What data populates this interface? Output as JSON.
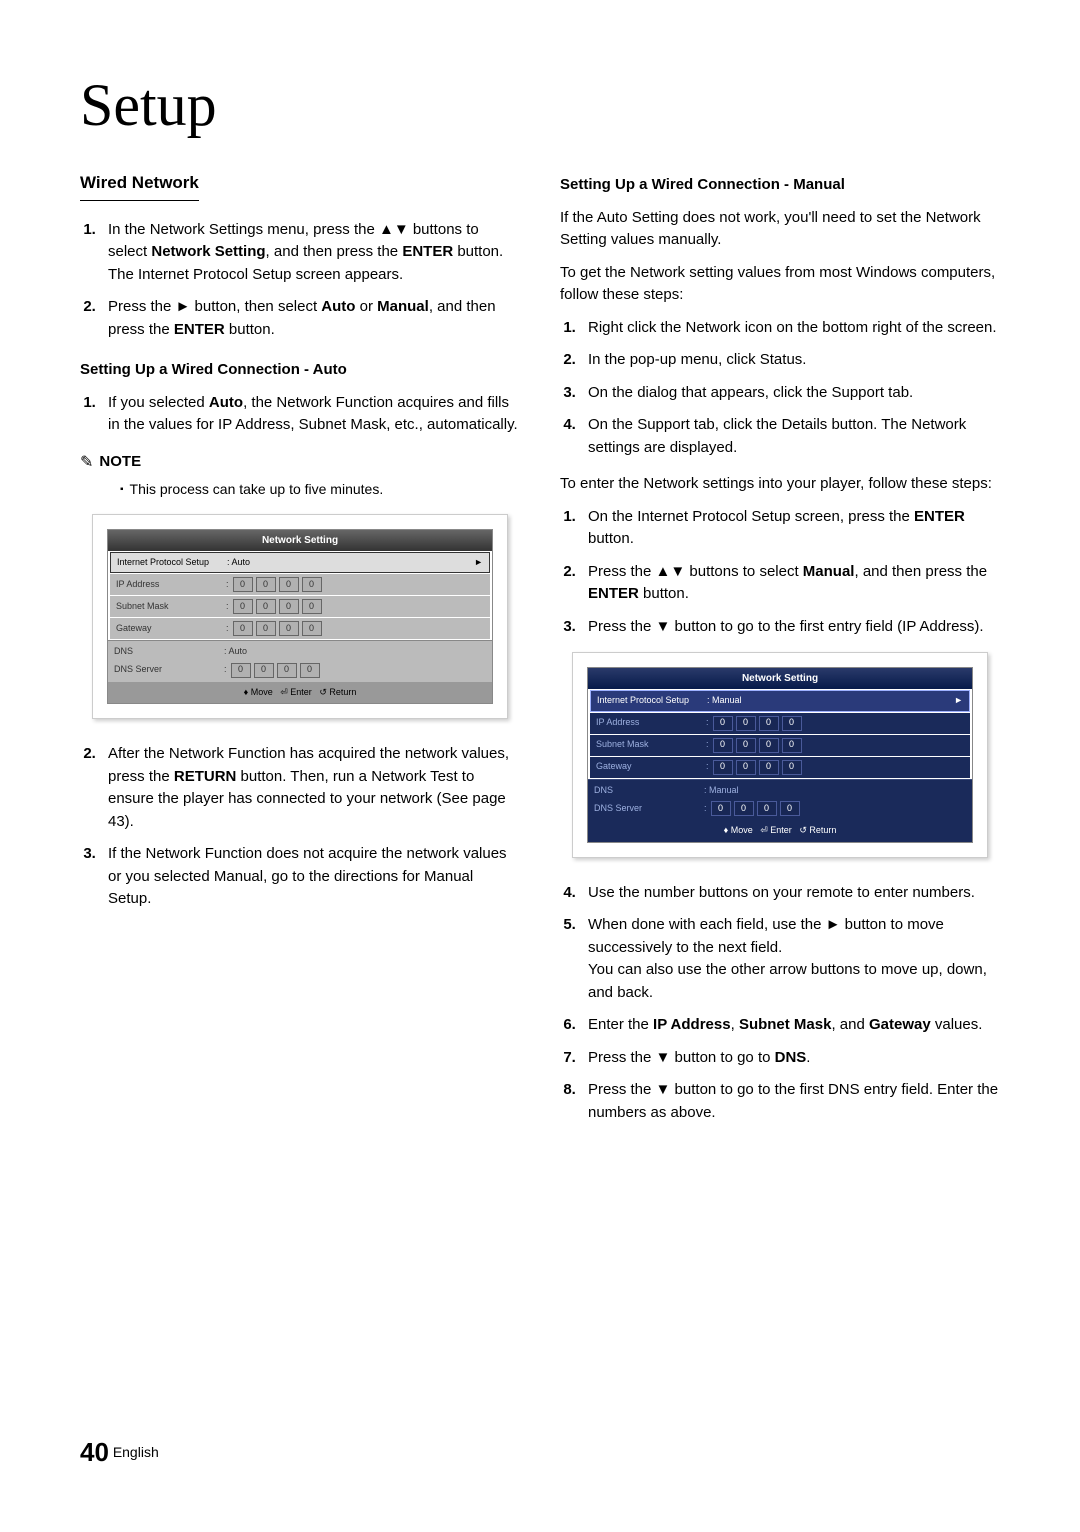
{
  "title": "Setup",
  "page_number": "40",
  "lang": "English",
  "left": {
    "section": "Wired Network",
    "steps_a": [
      "In the Network Settings menu, press the ▲▼ buttons to select Network Setting, and then press the ENTER button. The Internet Protocol Setup screen appears.",
      "Press the ► button, then select Auto or Manual, and then press the ENTER button."
    ],
    "sub_a": "Setting Up a Wired Connection - Auto",
    "steps_b": [
      "If you selected Auto, the Network Function acquires and fills in the values for IP Address, Subnet Mask, etc., automatically."
    ],
    "note_label": "NOTE",
    "note_body": "This process can take up to five minutes.",
    "steps_c": [
      "After the Network Function has acquired the network values, press the RETURN button. Then, run a Network Test to ensure the player has connected to your network (See page 43).",
      "If the Network Function does not acquire the network values or you selected Manual, go to the directions for Manual Setup."
    ]
  },
  "right": {
    "sub": "Setting Up a Wired Connection - Manual",
    "p1": "If the Auto Setting does not work, you'll need to set the Network Setting values manually.",
    "p2": "To get the Network setting values from most Windows computers, follow these steps:",
    "steps_a": [
      "Right click the Network icon on the bottom right of the screen.",
      "In the pop-up menu, click Status.",
      "On the dialog that appears, click the Support tab.",
      "On the Support tab, click the Details button. The Network settings are displayed."
    ],
    "p3": "To enter the Network settings into your player, follow these steps:",
    "steps_b": [
      "On the Internet Protocol Setup screen, press the ENTER button.",
      "Press the ▲▼ buttons to select Manual, and then press the ENTER button.",
      "Press the ▼ button to go to the first entry field (IP Address)."
    ],
    "steps_c": [
      "Use the number buttons on your remote to enter numbers.",
      "When done with each field, use the ► button to move successively to the next field. You can also use the other arrow buttons to move up, down, and back.",
      "Enter the IP Address, Subnet Mask, and Gateway values.",
      "Press the ▼ button to go to DNS.",
      "Press the ▼ button to go to the first DNS entry field. Enter the numbers as above."
    ]
  },
  "screen": {
    "title": "Network Setting",
    "ips_label": "Internet Protocol Setup",
    "auto": ": Auto",
    "manual": ": Manual",
    "ip": "IP Address",
    "subnet": "Subnet Mask",
    "gateway": "Gateway",
    "dns": "DNS",
    "dns_server": "DNS Server",
    "footer_move": "Move",
    "footer_enter": "Enter",
    "footer_return": "Return",
    "oct": "0"
  }
}
